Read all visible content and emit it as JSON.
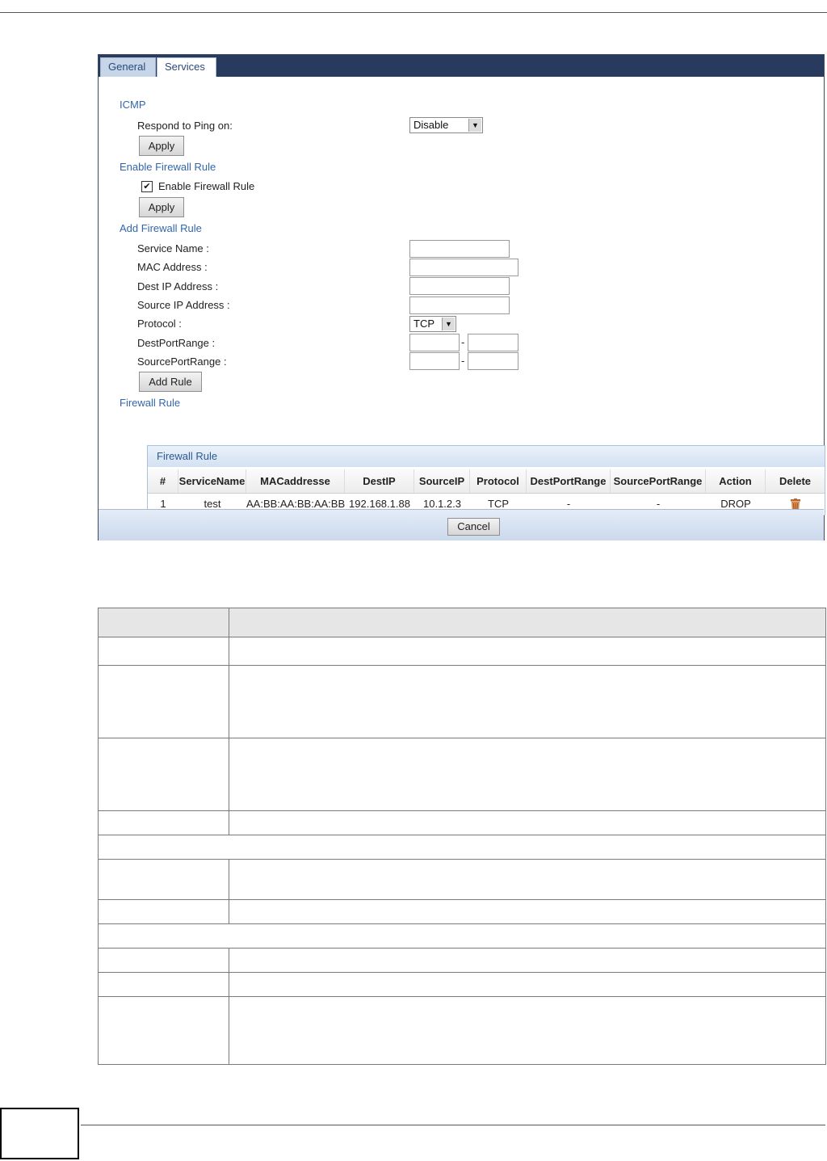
{
  "tabs": [
    "General",
    "Services"
  ],
  "icmp": {
    "title": "ICMP",
    "ping_label": "Respond to Ping on:",
    "ping_value": "Disable",
    "apply_label": "Apply"
  },
  "enable_fw": {
    "title": "Enable Firewall Rule",
    "checkbox_label": "Enable Firewall Rule",
    "checked": true,
    "apply_label": "Apply"
  },
  "add_rule": {
    "title": "Add Firewall Rule",
    "service_name_label": "Service Name :",
    "mac_label": "MAC Address :",
    "dest_ip_label": "Dest IP Address :",
    "source_ip_label": "Source IP Address :",
    "protocol_label": "Protocol :",
    "protocol_value": "TCP",
    "dest_port_label": "DestPortRange :",
    "source_port_label": "SourcePortRange :",
    "dash": "-",
    "add_button": "Add Rule"
  },
  "firewall_table": {
    "section_title": "Firewall Rule",
    "box_title": "Firewall Rule",
    "columns": [
      "#",
      "ServiceName",
      "MACaddresse",
      "DestIP",
      "SourceIP",
      "Protocol",
      "DestPortRange",
      "SourcePortRange",
      "Action",
      "Delete"
    ],
    "rows": [
      [
        "1",
        "test",
        "AA:BB:AA:BB:AA:BB",
        "192.168.1.88",
        "10.1.2.3",
        "TCP",
        "-",
        "-",
        "DROP"
      ]
    ]
  },
  "cancel_label": "Cancel"
}
